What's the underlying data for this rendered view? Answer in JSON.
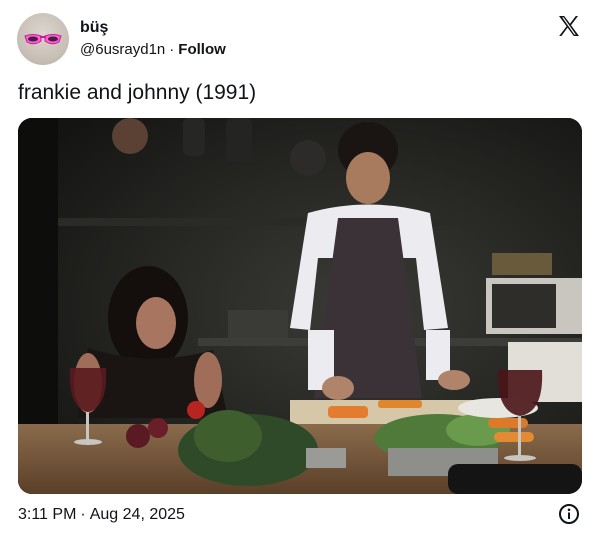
{
  "author": {
    "display_name": "büş",
    "handle": "@6usrayd1n",
    "separator": "·",
    "follow_label": "Follow"
  },
  "tweet": {
    "text": "frankie and johnny (1991)"
  },
  "meta": {
    "time": "3:11 PM",
    "separator": "·",
    "date": "Aug 24, 2025"
  },
  "icons": {
    "logo": "x-logo-icon",
    "info": "info-icon"
  },
  "colors": {
    "text": "#0f1419",
    "background": "#ffffff"
  }
}
